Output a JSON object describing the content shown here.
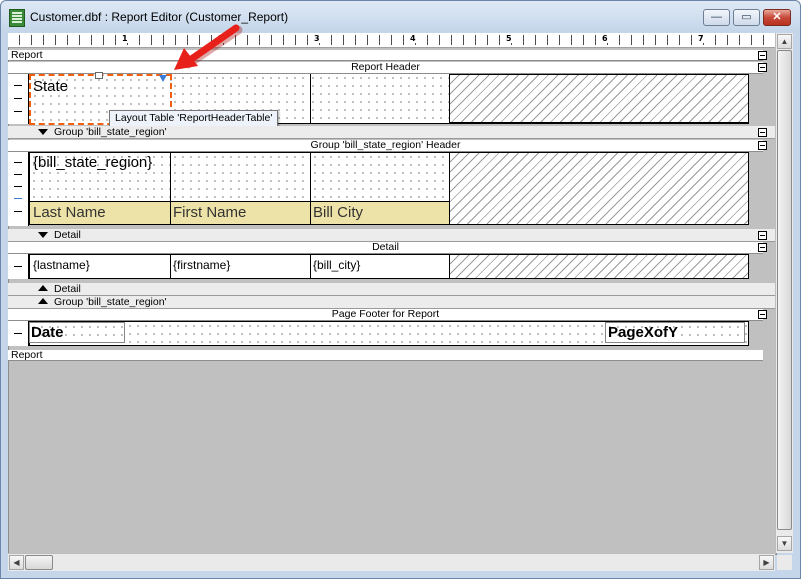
{
  "window": {
    "title": "Customer.dbf : Report Editor (Customer_Report)",
    "minimize_glyph": "—",
    "maximize_glyph": "▭",
    "close_glyph": "✕"
  },
  "ruler": {
    "numbers": [
      "1",
      "2",
      "3",
      "4",
      "5",
      "6",
      "7"
    ]
  },
  "bands": {
    "report_top_label": "Report",
    "report_header_label": "Report Header",
    "group_footer_collapsed_label": "Group 'bill_state_region'",
    "group_header_label": "Group 'bill_state_region' Header",
    "detail_collapsed_label": "Detail",
    "detail_label": "Detail",
    "detail_footer_label": "Detail",
    "group_footer_label": "Group 'bill_state_region'",
    "page_footer_label": "Page Footer for Report",
    "report_bottom_label": "Report"
  },
  "report_header": {
    "state_text": "State"
  },
  "tooltip": {
    "text": "Layout Table 'ReportHeaderTable'"
  },
  "group_header": {
    "field": "{bill_state_region}",
    "columns": [
      "Last Name",
      "First Name",
      "Bill City"
    ]
  },
  "detail": {
    "fields": [
      "{lastname}",
      "{firstname}",
      "{bill_city}"
    ]
  },
  "page_footer": {
    "date_text": "Date",
    "page_text": "PageXofY"
  },
  "colors": {
    "selection_orange": "#f06010",
    "header_cell_fill": "#ede3a8",
    "arrow_red": "#e8201a",
    "canvas_gray": "#c0c0c0"
  },
  "icons": {
    "app": "spreadsheet-icon",
    "pointer": "red-arrow-icon"
  }
}
